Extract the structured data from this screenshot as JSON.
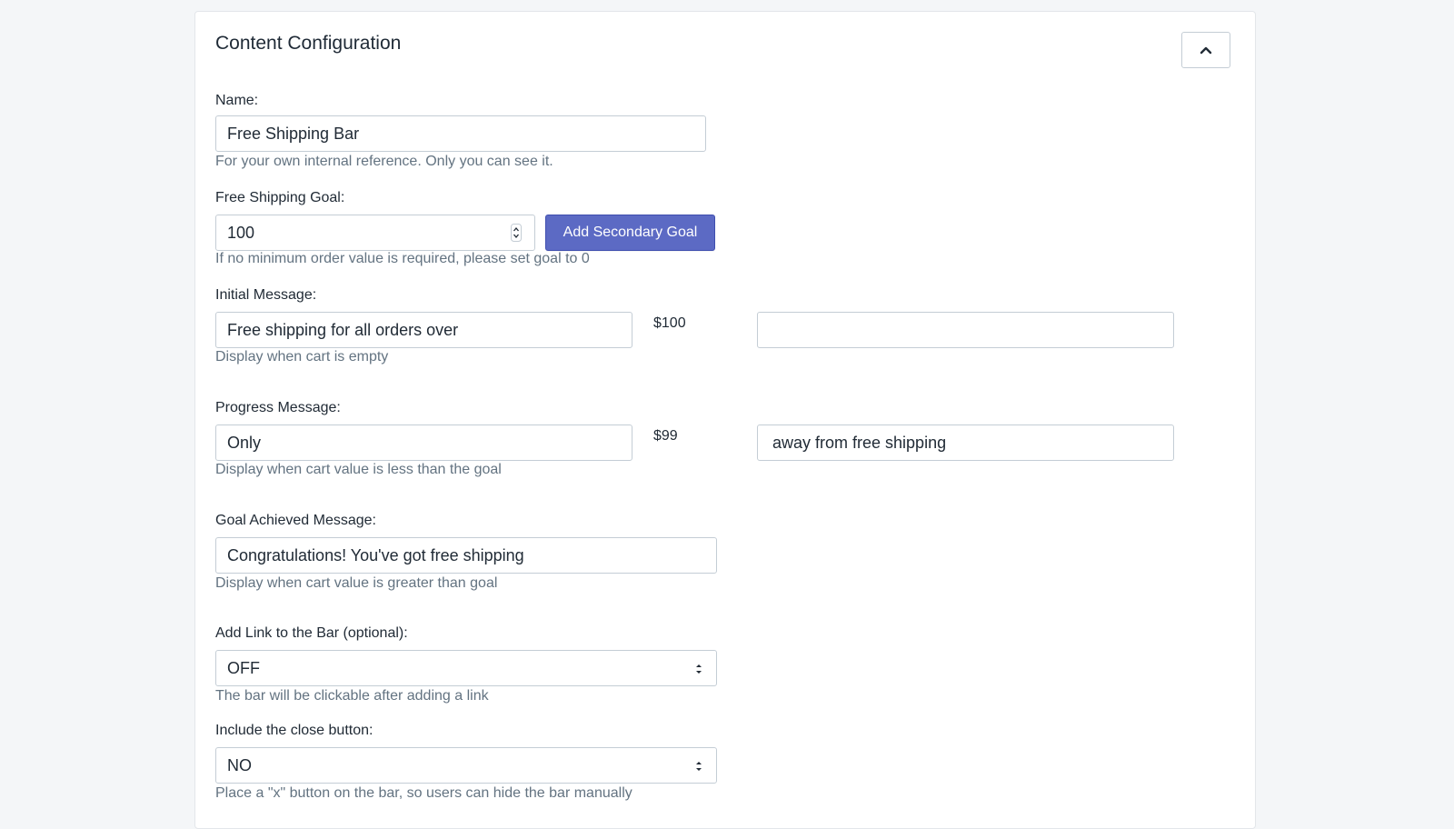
{
  "section": {
    "title": "Content Configuration",
    "collapse_icon": "chevron-up-icon"
  },
  "name": {
    "label": "Name:",
    "value": "Free Shipping Bar",
    "help": "For your own internal reference. Only you can see it."
  },
  "goal": {
    "label": "Free Shipping Goal:",
    "value": "100",
    "button": "Add Secondary Goal",
    "help": "If no minimum order value is required, please set goal to 0"
  },
  "initial": {
    "label": "Initial Message:",
    "prefix": "Free shipping for all orders over",
    "amount": "$100",
    "suffix": "",
    "help": "Display when cart is empty"
  },
  "progress": {
    "label": "Progress Message:",
    "prefix": "Only",
    "amount": "$99",
    "suffix": "away from free shipping",
    "help": "Display when cart value is less than the goal"
  },
  "achieved": {
    "label": "Goal Achieved Message:",
    "value": "Congratulations! You've got free shipping",
    "help": "Display when cart value is greater than goal"
  },
  "link": {
    "label": "Add Link to the Bar (optional):",
    "selected": "OFF",
    "help": "The bar will be clickable after adding a link"
  },
  "close_button": {
    "label": "Include the close button:",
    "selected": "NO",
    "help": "Place a \"x\" button on the bar, so users can hide the bar manually"
  },
  "colors": {
    "primary": "#5c6ac4",
    "border": "#c4cdd5",
    "help_text": "#637381"
  }
}
